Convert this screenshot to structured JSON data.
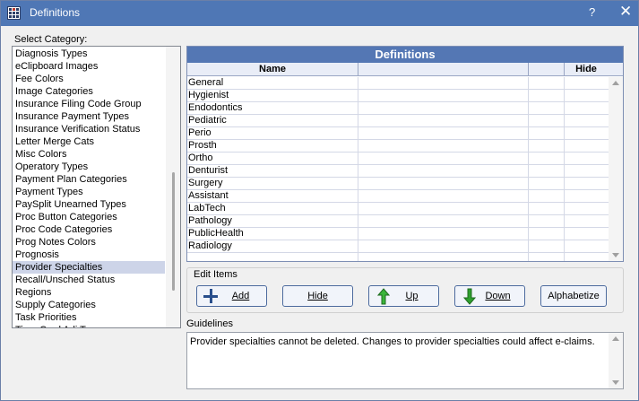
{
  "window": {
    "title": "Definitions",
    "help_label": "?",
    "close_label": "✕"
  },
  "categories": {
    "label": "Select Category:",
    "selected_index": 17,
    "items": [
      "Diagnosis Types",
      "eClipboard Images",
      "Fee Colors",
      "Image Categories",
      "Insurance Filing Code Group",
      "Insurance Payment Types",
      "Insurance Verification Status",
      "Letter Merge Cats",
      "Misc Colors",
      "Operatory Types",
      "Payment Plan Categories",
      "Payment Types",
      "PaySplit Unearned Types",
      "Proc Button Categories",
      "Proc Code Categories",
      "Prog Notes Colors",
      "Prognosis",
      "Provider Specialties",
      "Recall/Unsched Status",
      "Regions",
      "Supply Categories",
      "Task Priorities",
      "Time Card Adj Types"
    ]
  },
  "grid": {
    "title": "Definitions",
    "columns": {
      "name": "Name",
      "hide": "Hide"
    },
    "rows": [
      "General",
      "Hygienist",
      "Endodontics",
      "Pediatric",
      "Perio",
      "Prosth",
      "Ortho",
      "Denturist",
      "Surgery",
      "Assistant",
      "LabTech",
      "Pathology",
      "PublicHealth",
      "Radiology"
    ]
  },
  "edit_items": {
    "label": "Edit Items",
    "add": "Add",
    "hide": "Hide",
    "up": "Up",
    "down": "Down",
    "alphabetize": "Alphabetize"
  },
  "guidelines": {
    "label": "Guidelines",
    "text": "Provider specialties cannot be deleted.  Changes to provider specialties could affect e-claims."
  },
  "colors": {
    "title_bar": "#4f77b5",
    "grid_header": "#5477b4",
    "selected_item": "#cdd4e8",
    "up_arrow": "#3ab53a",
    "down_arrow": "#2fa02f"
  }
}
